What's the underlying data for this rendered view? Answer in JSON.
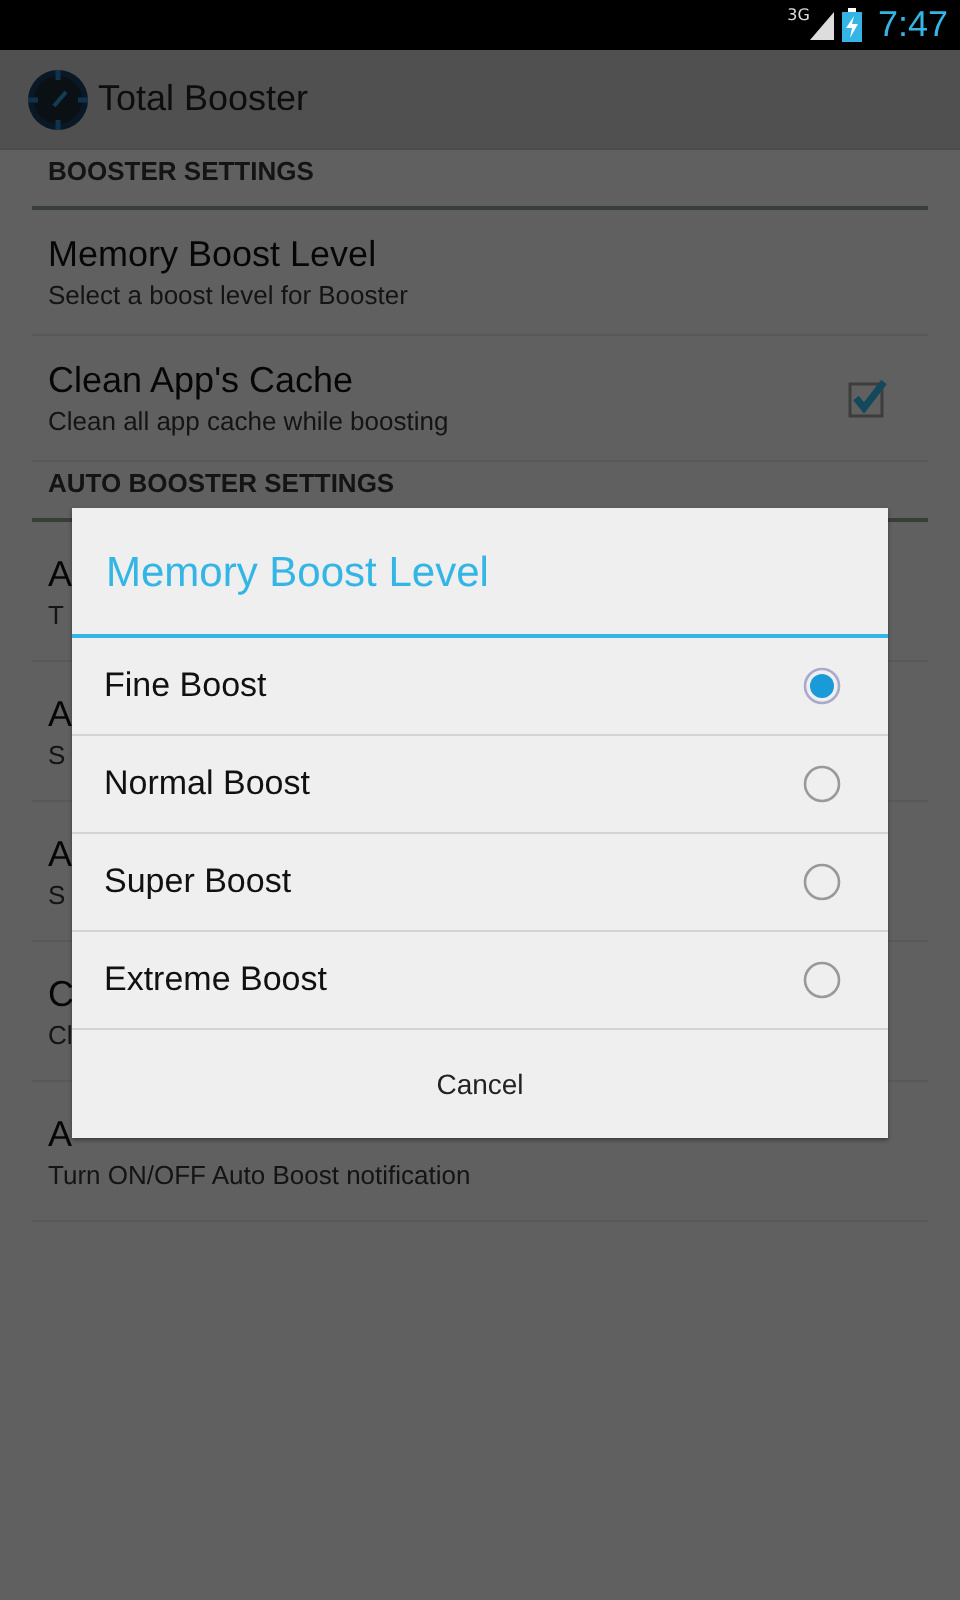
{
  "status_bar": {
    "network": "3G",
    "time": "7:47"
  },
  "action_bar": {
    "title": "Total Booster"
  },
  "sections": [
    {
      "header": "BOOSTER SETTINGS",
      "items": [
        {
          "title": "Memory Boost Level",
          "summary": "Select a boost level for Booster",
          "kind": "plain"
        },
        {
          "title": "Clean App's Cache",
          "summary": "Clean all app cache while boosting",
          "kind": "checkbox",
          "checked": true
        }
      ]
    },
    {
      "header": "AUTO BOOSTER SETTINGS",
      "items": [
        {
          "title": "A",
          "summary": "T",
          "kind": "plain"
        },
        {
          "title": "A",
          "summary": "S",
          "kind": "plain"
        },
        {
          "title": "A",
          "summary": "S",
          "kind": "plain"
        },
        {
          "title": "C",
          "summary": "Cl",
          "kind": "plain"
        },
        {
          "title": "A",
          "summary": "Turn ON/OFF Auto Boost notification",
          "kind": "plain"
        }
      ]
    }
  ],
  "dialog": {
    "title": "Memory Boost Level",
    "options": [
      {
        "label": "Fine Boost",
        "selected": true
      },
      {
        "label": "Normal Boost",
        "selected": false
      },
      {
        "label": "Super Boost",
        "selected": false
      },
      {
        "label": "Extreme Boost",
        "selected": false
      }
    ],
    "cancel": "Cancel"
  }
}
